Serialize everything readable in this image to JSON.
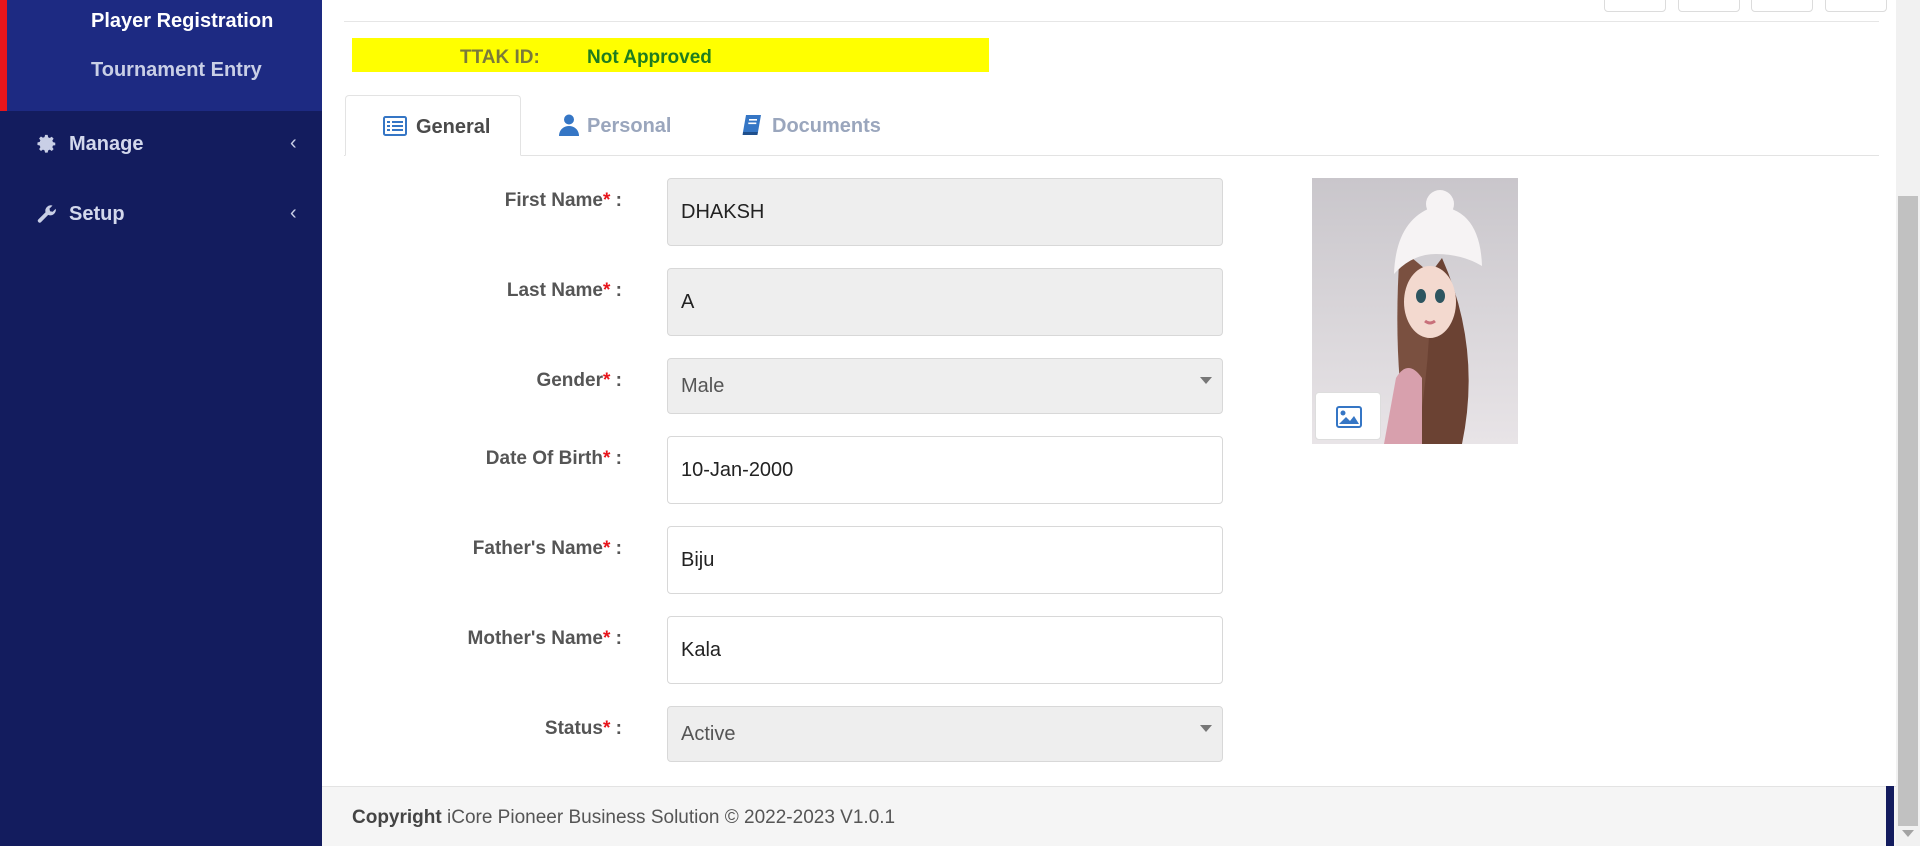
{
  "sidebar": {
    "submenu": [
      {
        "label": "Player Registration"
      },
      {
        "label": "Tournament Entry"
      }
    ],
    "items": [
      {
        "label": "Manage",
        "icon": "gear-icon"
      },
      {
        "label": "Setup",
        "icon": "wrench-icon"
      }
    ]
  },
  "status_bar": {
    "ttak_label": "TTAK ID:",
    "approval_status": "Not Approved",
    "background_color": "#ffff00"
  },
  "tabs": [
    {
      "label": "General",
      "icon": "list-icon",
      "active": true
    },
    {
      "label": "Personal",
      "icon": "user-icon",
      "active": false
    },
    {
      "label": "Documents",
      "icon": "book-icon",
      "active": false
    }
  ],
  "form": {
    "first_name": {
      "label": "First Name",
      "value": "DHAKSH"
    },
    "last_name": {
      "label": "Last Name",
      "value": "A"
    },
    "gender": {
      "label": "Gender",
      "value": "Male"
    },
    "dob": {
      "label": "Date Of Birth",
      "value": "10-Jan-2000"
    },
    "father": {
      "label": "Father's Name",
      "value": "Biju"
    },
    "mother": {
      "label": "Mother's Name",
      "value": "Kala"
    },
    "status": {
      "label": "Status",
      "value": "Active"
    },
    "required_mark": "*",
    "separator": ":"
  },
  "photo": {
    "upload_icon": "image-icon"
  },
  "footer": {
    "copyright_label": "Copyright",
    "text": "iCore Pioneer Business Solution © 2022-2023 V1.0.1"
  },
  "colors": {
    "sidebar": "#131c5e",
    "submenu": "#1d2a82",
    "accent": "#e8151b",
    "approved_text": "#1f7d1f"
  }
}
